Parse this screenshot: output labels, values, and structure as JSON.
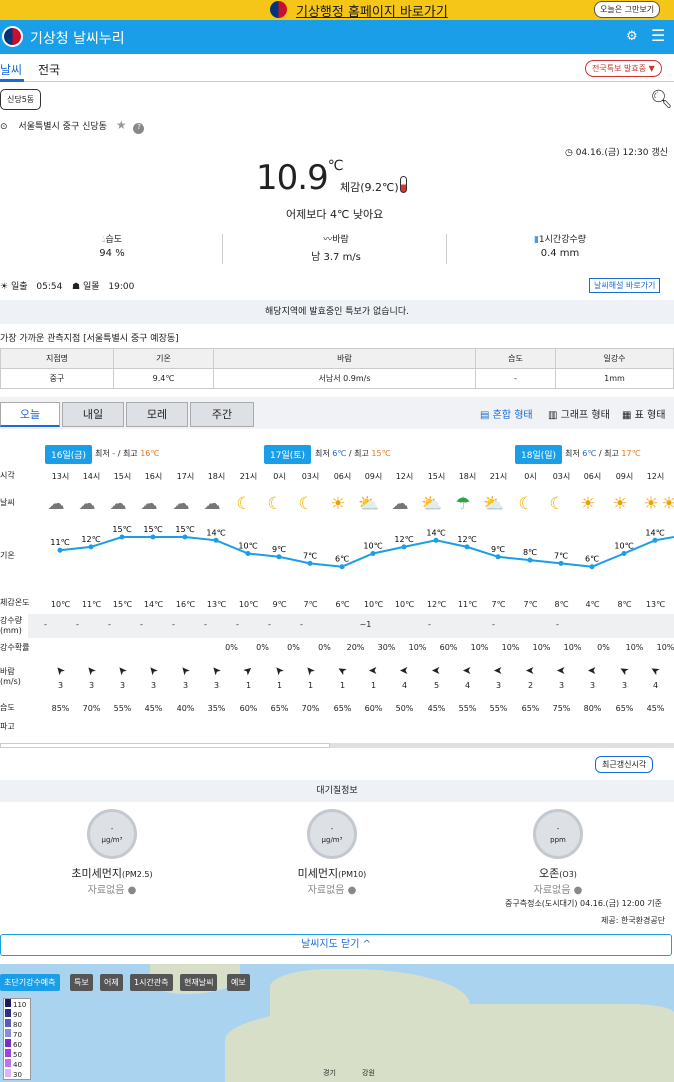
{
  "topbar": {
    "link": "기상행정 홈페이지 바로가기",
    "stop": "오늘은 그만보기"
  },
  "header": {
    "title": "기상청 날씨누리"
  },
  "nav": {
    "tab1": "날씨",
    "tab2": "전국",
    "issue_btn": "전국특보 발효중 ▼"
  },
  "location": {
    "btn": "신당5동",
    "address": "서울특별시 중구 신당동",
    "updated": "04.16.(금) 12:30 갱신"
  },
  "current": {
    "temp": "10.9",
    "unit": "℃",
    "feels": "체감(9.2℃)",
    "compare": "어제보다 4℃ 낮아요",
    "humidity_label": "습도",
    "humidity": "94 %",
    "wind_label": "바람",
    "wind": "남 3.7 m/s",
    "rain_label": "1시간강수량",
    "rain": "0.4 mm",
    "sunrise_label": "일출",
    "sunrise": "05:54",
    "sunset_label": "일몰",
    "sunset": "19:00",
    "guide_btn": "날씨해설 바로가기"
  },
  "alert": "해당지역에 발효중인 특보가 없습니다.",
  "observation": {
    "title": "가장 가까운 관측지점 [서울특별시 중구 예장동]",
    "headers": [
      "지점명",
      "기온",
      "바람",
      "습도",
      "일강수"
    ],
    "row": [
      "중구",
      "9.4℃",
      "서남서 0.9m/s",
      "-",
      "1mm"
    ]
  },
  "forecast_tabs": [
    "오늘",
    "내일",
    "모레",
    "주간"
  ],
  "view_opts": [
    "혼합 형태",
    "그래프 형태",
    "표 형태"
  ],
  "days": [
    {
      "badge": "16일(금)",
      "min_label": "최저",
      "min": "-",
      "max_label": "최고",
      "max": "16℃"
    },
    {
      "badge": "17일(토)",
      "min_label": "최저",
      "min": "6℃",
      "max_label": "최고",
      "max": "15℃"
    },
    {
      "badge": "18일(일)",
      "min_label": "최저",
      "min": "6℃",
      "max_label": "최고",
      "max": "17℃"
    }
  ],
  "row_labels": {
    "time": "시각",
    "weather": "날씨",
    "temp": "기온",
    "feels": "체감온도",
    "precip": "강수량\n(mm)",
    "prob": "강수확률",
    "wind": "바람\n(m/s)",
    "humid": "습도",
    "wave": "파고"
  },
  "hours": [
    "13시",
    "14시",
    "15시",
    "16시",
    "17시",
    "18시",
    "21시",
    "0시",
    "03시",
    "06시",
    "09시",
    "12시",
    "15시",
    "18시",
    "21시",
    "0시",
    "03시",
    "06시",
    "09시",
    "12시"
  ],
  "icons": [
    "cloud",
    "cloud",
    "cloud",
    "cloud",
    "cloud",
    "cloud",
    "moon",
    "moon",
    "moon",
    "sun",
    "partly",
    "cloud",
    "partly",
    "umbrella",
    "partly",
    "moon",
    "moon",
    "sun",
    "sun",
    "sun",
    "sun"
  ],
  "temps": [
    "11℃",
    "12℃",
    "15℃",
    "15℃",
    "15℃",
    "14℃",
    "10℃",
    "9℃",
    "7℃",
    "6℃",
    "10℃",
    "12℃",
    "14℃",
    "12℃",
    "9℃",
    "8℃",
    "7℃",
    "6℃",
    "10℃",
    "14℃"
  ],
  "feels": [
    "10℃",
    "11℃",
    "15℃",
    "14℃",
    "16℃",
    "13℃",
    "10℃",
    "9℃",
    "7℃",
    "6℃",
    "10℃",
    "10℃",
    "12℃",
    "11℃",
    "7℃",
    "7℃",
    "8℃",
    "4℃",
    "8℃",
    "13℃"
  ],
  "precip": [
    "-",
    "-",
    "-",
    "-",
    "-",
    "-",
    "-",
    "-",
    "-",
    "",
    "~1",
    "",
    "-",
    "",
    "-",
    "",
    "-",
    "",
    ""
  ],
  "prob": [
    "0%",
    "0%",
    "0%",
    "0%",
    "20%",
    "30%",
    "10%",
    "60%",
    "10%",
    "10%",
    "10%",
    "10%",
    "0%",
    "10%",
    "10%",
    "0%"
  ],
  "wind_speed": [
    "3",
    "3",
    "3",
    "3",
    "3",
    "3",
    "1",
    "1",
    "1",
    "1",
    "1",
    "4",
    "5",
    "4",
    "3",
    "2",
    "3",
    "3",
    "3",
    "4"
  ],
  "humid": [
    "85%",
    "70%",
    "55%",
    "45%",
    "40%",
    "35%",
    "60%",
    "65%",
    "70%",
    "65%",
    "60%",
    "50%",
    "45%",
    "55%",
    "55%",
    "65%",
    "75%",
    "80%",
    "65%",
    "45%"
  ],
  "air": {
    "refresh_btn": "최근갱신시각",
    "title": "대기질정보",
    "items": [
      {
        "val": "-",
        "unit": "μg/m³",
        "name": "초미세먼지",
        "sub": "(PM2.5)",
        "status": "자료없음"
      },
      {
        "val": "-",
        "unit": "μg/m³",
        "name": "미세먼지",
        "sub": "(PM10)",
        "status": "자료없음"
      },
      {
        "val": "-",
        "unit": "ppm",
        "name": "오존",
        "sub": "(O3)",
        "status": "자료없음"
      }
    ],
    "source": "중구측정소(도시대기) 04.16.(금) 12:00 기준",
    "provider": "제공: 한국환경공단"
  },
  "map": {
    "close": "날씨지도 닫기 ^",
    "tabs": [
      "초단기강수예측",
      "특보",
      "어제",
      "1시간관측",
      "현재날씨",
      "예보"
    ],
    "legend": [
      "110",
      "90",
      "80",
      "70",
      "60",
      "50",
      "40",
      "30"
    ],
    "labels": [
      "경기",
      "강원"
    ]
  },
  "colors": {
    "accent": "#1a9ee8",
    "topbar": "#f5c518",
    "max": "#e8761c",
    "min": "#1a6ad9"
  }
}
